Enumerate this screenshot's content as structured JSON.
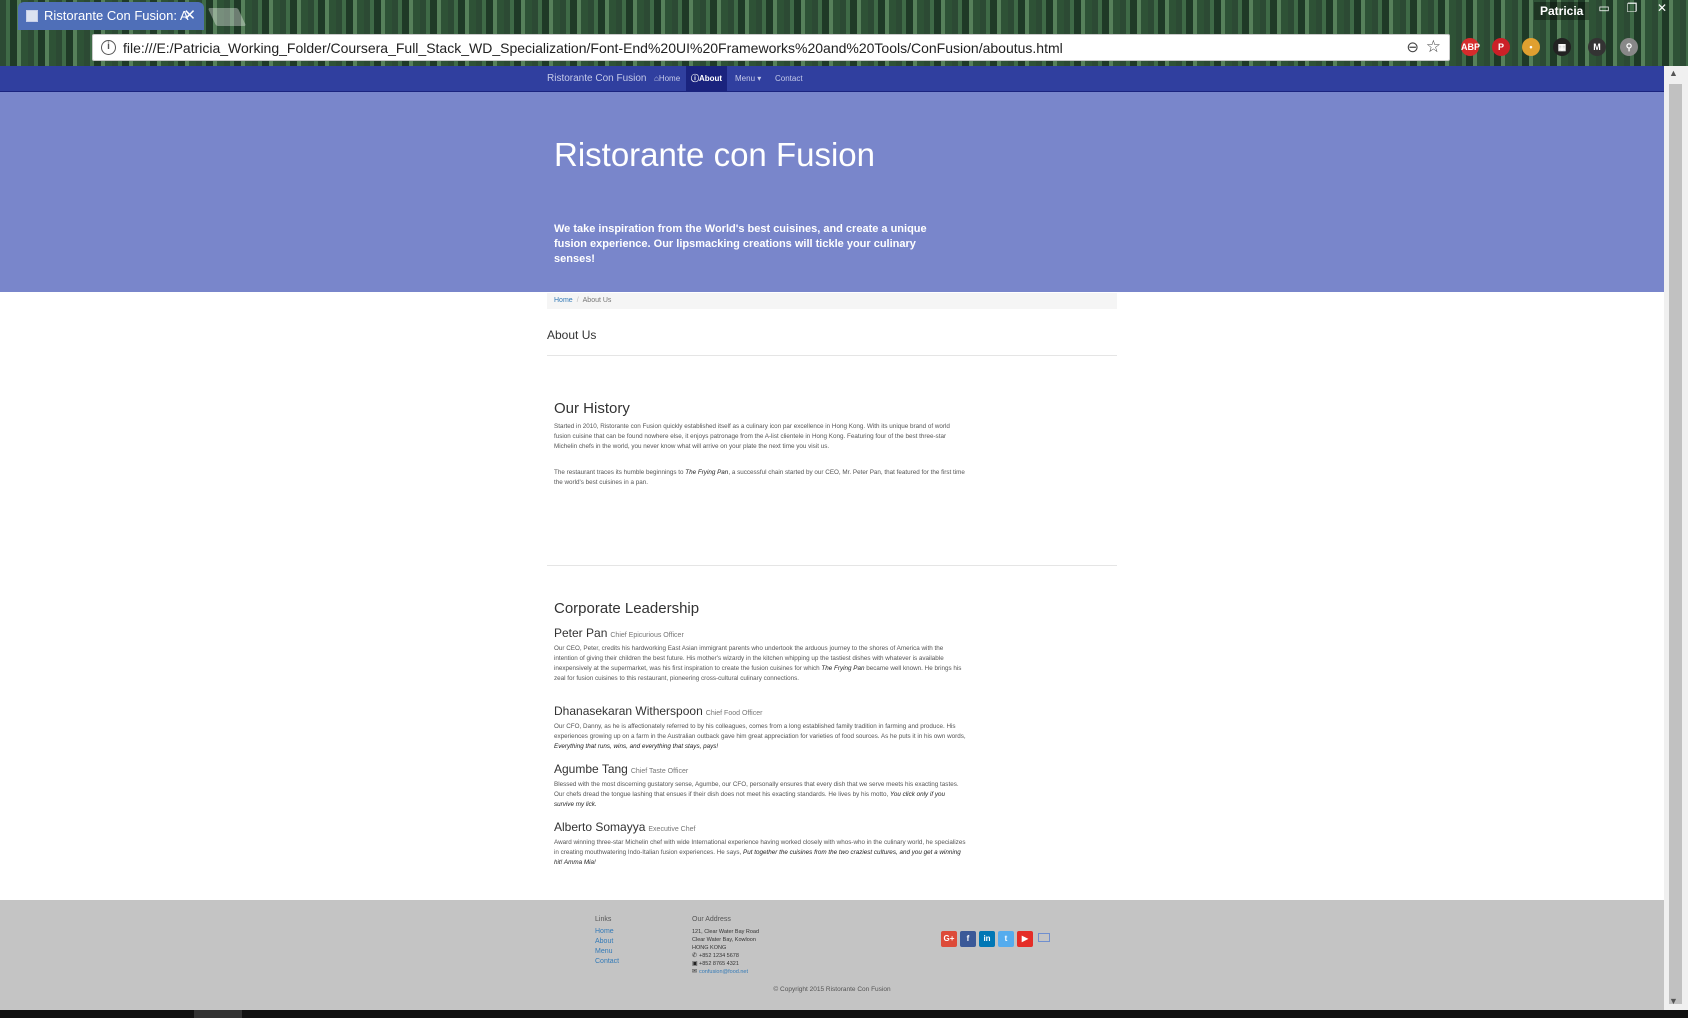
{
  "browser": {
    "tab_title": "Ristorante Con Fusion: A",
    "tab_close": "✕",
    "profile_name": "Patricia",
    "url": "file:///E:/Patricia_Working_Folder/Coursera_Full_Stack_WD_Specialization/Font-End%20UI%20Frameworks%20and%20Tools/ConFusion/aboutus.html",
    "extensions": [
      {
        "name": "adblock-plus-icon",
        "label": "ABP",
        "color": "#d62c2c"
      },
      {
        "name": "pinterest-icon",
        "label": "P",
        "color": "#cb2027"
      },
      {
        "name": "colorful-extension-icon",
        "label": "•",
        "color": "#e0a030"
      },
      {
        "name": "qr-extension-icon",
        "label": "▦",
        "color": "#222222"
      },
      {
        "name": "gmail-icon",
        "label": "M",
        "color": "#333333"
      },
      {
        "name": "pdf-icon",
        "label": "⚲",
        "color": "#888888"
      }
    ]
  },
  "navbar": {
    "brand": "Ristorante Con Fusion",
    "items": [
      {
        "label": "⌂Home",
        "active": false
      },
      {
        "label": "ⓘAbout",
        "active": true
      },
      {
        "label": "Menu ▾",
        "active": false
      },
      {
        "label": "Contact",
        "active": false
      }
    ]
  },
  "jumbotron": {
    "title": "Ristorante con Fusion",
    "tagline": "We take inspiration from the World's best cuisines, and create a unique fusion experience. Our lipsmacking creations will tickle your culinary senses!"
  },
  "breadcrumb": {
    "home": "Home",
    "separator": "/",
    "current": "About Us"
  },
  "page_title": "About Us",
  "history": {
    "title": "Our History",
    "para1": "Started in 2010, Ristorante con Fusion quickly established itself as a culinary icon par excellence in Hong Kong. With its unique brand of world fusion cuisine that can be found nowhere else, it enjoys patronage from the A-list clientele in Hong Kong. Featuring four of the best three-star Michelin chefs in the world, you never know what will arrive on your plate the next time you visit us.",
    "para2_start": "The restaurant traces its humble beginnings to ",
    "para2_em": "The Frying Pan",
    "para2_end": ", a successful chain started by our CEO, Mr. Peter Pan, that featured for the first time the world's best cuisines in a pan."
  },
  "leadership": {
    "title": "Corporate Leadership",
    "leaders": [
      {
        "name": "Peter Pan",
        "role": "Chief Epicurious Officer",
        "bio_start": "Our CEO, Peter, credits his hardworking East Asian immigrant parents who undertook the arduous journey to the shores of America with the intention of giving their children the best future. His mother's wizardy in the kitchen whipping up the tastiest dishes with whatever is available inexpensively at the supermarket, was his first inspiration to create the fusion cuisines for which ",
        "bio_em": "The Frying Pan",
        "bio_end": " became well known. He brings his zeal for fusion cuisines to this restaurant, pioneering cross-cultural culinary connections."
      },
      {
        "name": "Dhanasekaran Witherspoon",
        "role": "Chief Food Officer",
        "bio_start": "Our CFO, Danny, as he is affectionately referred to by his colleagues, comes from a long established family tradition in farming and produce. His experiences growing up on a farm in the Australian outback gave him great appreciation for varieties of food sources. As he puts it in his own words, ",
        "bio_em": "Everything that runs, wins, and everything that stays, pays!",
        "bio_end": ""
      },
      {
        "name": "Agumbe Tang",
        "role": "Chief Taste Officer",
        "bio_start": "Blessed with the most discerning gustatory sense, Agumbe, our CFO, personally ensures that every dish that we serve meets his exacting tastes. Our chefs dread the tongue lashing that ensues if their dish does not meet his exacting standards. He lives by his motto, ",
        "bio_em": "You click only if you survive my lick.",
        "bio_end": ""
      },
      {
        "name": "Alberto Somayya",
        "role": "Executive Chef",
        "bio_start": "Award winning three-star Michelin chef with wide International experience having worked closely with whos-who in the culinary world, he specializes in creating mouthwatering Indo-Italian fusion experiences. He says, ",
        "bio_em": "Put together the cuisines from the two craziest cultures, and you get a winning hit! Amma Mia!",
        "bio_end": ""
      }
    ]
  },
  "footer": {
    "links_title": "Links",
    "links": [
      "Home",
      "About",
      "Menu",
      "Contact"
    ],
    "address_title": "Our Address",
    "address_lines": [
      "121, Clear Water Bay Road",
      "Clear Water Bay, Kowloon",
      "HONG KONG"
    ],
    "phone": "+852 1234 5678",
    "fax": "+852 8765 4321",
    "email": "confusion@food.net",
    "social": [
      {
        "name": "google-plus-icon",
        "label": "G+",
        "color": "#dd4b39"
      },
      {
        "name": "facebook-icon",
        "label": "f",
        "color": "#3b5998"
      },
      {
        "name": "linkedin-icon",
        "label": "in",
        "color": "#0077b5"
      },
      {
        "name": "twitter-icon",
        "label": "t",
        "color": "#55acee"
      },
      {
        "name": "youtube-icon",
        "label": "▶",
        "color": "#e52d27"
      }
    ],
    "copyright": "© Copyright 2015 Ristorante Con Fusion"
  }
}
